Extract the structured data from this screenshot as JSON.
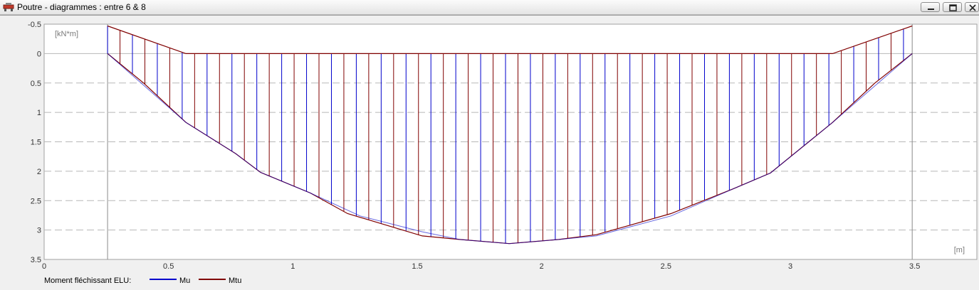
{
  "window": {
    "title": "Poutre - diagrammes : entre 6 & 8",
    "icon": "beam-app-icon",
    "buttons": [
      "minimize-icon",
      "restore-icon",
      "close-icon"
    ]
  },
  "chart_data": {
    "type": "line",
    "title": "",
    "xlabel": "[m]",
    "ylabel": "[kN*m]",
    "xlim": [
      0,
      3.75
    ],
    "ylim": [
      -0.5,
      3.5
    ],
    "y_inverted": true,
    "grid": true,
    "x_ticks": [
      0,
      0.5,
      1,
      1.5,
      2,
      2.5,
      3,
      3.5
    ],
    "y_ticks": [
      -0.5,
      0,
      0.5,
      1,
      1.5,
      2,
      2.5,
      3,
      3.5
    ],
    "support_lines_x": [
      0.255,
      3.49
    ],
    "legend_title": "Moment fléchissant ELU:",
    "legend_position": "bottom-left",
    "series": [
      {
        "name": "Mu",
        "color": "#0000cc",
        "x": [
          0.255,
          0.57,
          0.77,
          0.87,
          1.07,
          1.27,
          1.52,
          1.67,
          1.87,
          2.07,
          2.22,
          2.52,
          2.77,
          2.92,
          3.17,
          3.49
        ],
        "y": [
          0,
          1.17,
          1.7,
          2.02,
          2.37,
          2.76,
          3.03,
          3.16,
          3.23,
          3.16,
          3.1,
          2.76,
          2.3,
          2.03,
          1.17,
          0
        ]
      },
      {
        "name": "Mtu",
        "color": "#800000",
        "x": [
          0.255,
          0.57,
          3.17,
          3.49
        ],
        "y": [
          -0.47,
          0,
          0,
          -0.47
        ]
      },
      {
        "name": "Mtu",
        "color": "#800000",
        "x": [
          0.255,
          0.4,
          0.57,
          0.77,
          0.87,
          1.07,
          1.22,
          1.52,
          1.67,
          1.87,
          2.07,
          2.22,
          2.52,
          2.77,
          2.92,
          3.17,
          3.34,
          3.49
        ],
        "y": [
          0,
          0.5,
          1.17,
          1.7,
          2.02,
          2.37,
          2.72,
          3.1,
          3.16,
          3.23,
          3.16,
          3.08,
          2.72,
          2.3,
          2.03,
          1.17,
          0.5,
          0
        ]
      }
    ],
    "hatch_step_m": 0.05
  }
}
